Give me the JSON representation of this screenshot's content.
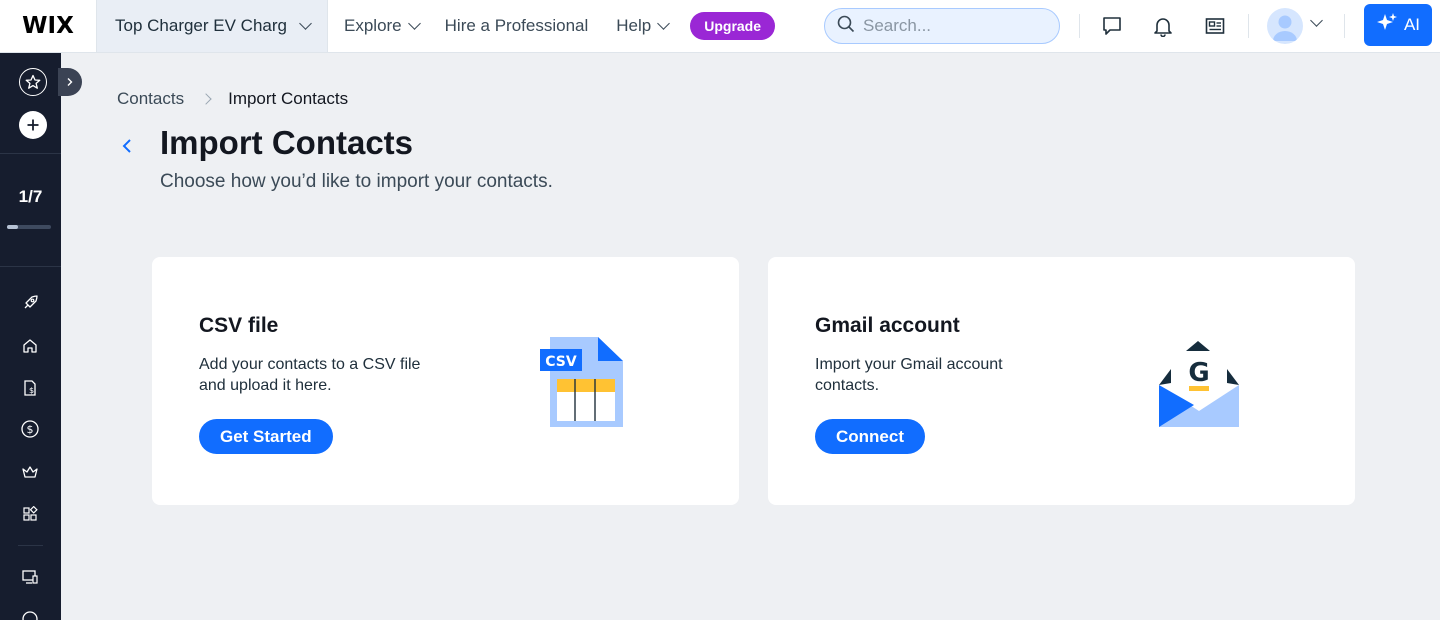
{
  "topbar": {
    "logo": "WIX",
    "site_name": "Top Charger EV Charg",
    "nav": [
      {
        "label": "Explore"
      },
      {
        "label": "Hire a Professional"
      },
      {
        "label": "Help"
      }
    ],
    "upgrade_label": "Upgrade",
    "search_placeholder": "Search...",
    "ai_label": "AI",
    "icons": [
      "chat-icon",
      "bell-icon",
      "news-icon",
      "avatar",
      "chevron-down-icon",
      "sparkle-icon"
    ]
  },
  "sidebar": {
    "progress_text": "1/7",
    "progress_fraction": 0.143,
    "icons": [
      "star-icon",
      "plus-icon",
      "rocket-icon",
      "home-icon",
      "invoice-icon",
      "dollar-icon",
      "crown-icon",
      "apps-icon",
      "devices-icon",
      "more-icon"
    ]
  },
  "breadcrumb": {
    "parent": "Contacts",
    "current": "Import Contacts"
  },
  "page": {
    "title": "Import Contacts",
    "subtitle": "Choose how you’d like to import your contacts."
  },
  "cards": [
    {
      "title": "CSV file",
      "description": "Add your contacts to a CSV file and upload it here.",
      "button": "Get Started",
      "illustration_label": "CSV"
    },
    {
      "title": "Gmail account",
      "description": "Import your Gmail account contacts.",
      "button": "Connect",
      "illustration_label": "G"
    }
  ],
  "colors": {
    "accent": "#116dff",
    "upgrade": "#9a27d5",
    "sidebar_bg": "#161d2e",
    "page_bg": "#eef0f3"
  }
}
